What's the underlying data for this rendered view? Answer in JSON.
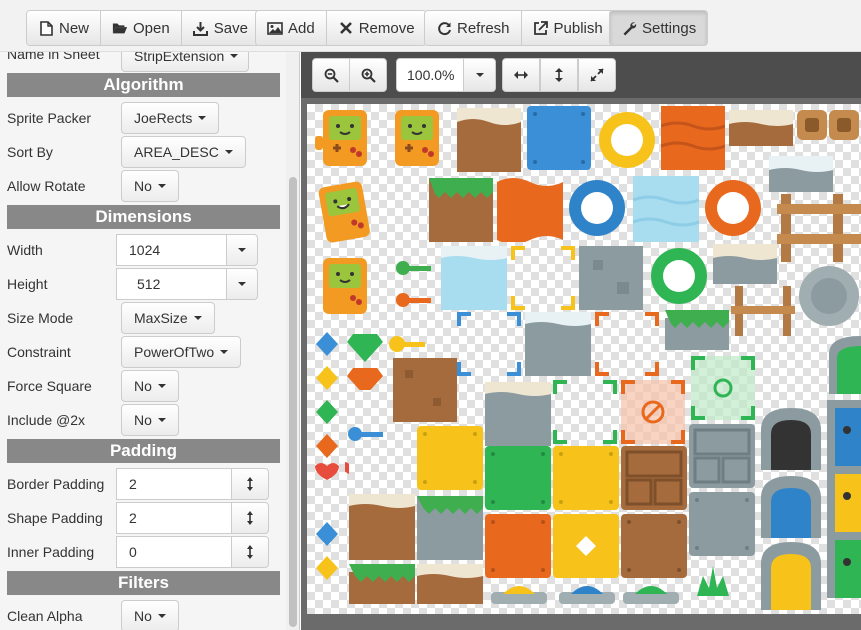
{
  "toolbar": {
    "new_label": "New",
    "open_label": "Open",
    "save_label": "Save",
    "add_label": "Add",
    "remove_label": "Remove",
    "refresh_label": "Refresh",
    "publish_label": "Publish",
    "settings_label": "Settings"
  },
  "sidebar": {
    "top_row": {
      "label": "Name in Sheet",
      "value": "StripExtension"
    },
    "algorithm": {
      "title": "Algorithm",
      "sprite_packer": {
        "label": "Sprite Packer",
        "value": "JoeRects"
      },
      "sort_by": {
        "label": "Sort By",
        "value": "AREA_DESC"
      },
      "allow_rotate": {
        "label": "Allow Rotate",
        "value": "No"
      }
    },
    "dimensions": {
      "title": "Dimensions",
      "width": {
        "label": "Width",
        "value": "1024"
      },
      "height": {
        "label": "Height",
        "value": "512"
      },
      "size_mode": {
        "label": "Size Mode",
        "value": "MaxSize"
      },
      "constraint": {
        "label": "Constraint",
        "value": "PowerOfTwo"
      },
      "force_square": {
        "label": "Force Square",
        "value": "No"
      },
      "include_2x": {
        "label": "Include @2x",
        "value": "No"
      }
    },
    "padding": {
      "title": "Padding",
      "border": {
        "label": "Border Padding",
        "value": "2"
      },
      "shape": {
        "label": "Shape Padding",
        "value": "2"
      },
      "inner": {
        "label": "Inner Padding",
        "value": "0"
      }
    },
    "filters": {
      "title": "Filters",
      "clean_alpha": {
        "label": "Clean Alpha",
        "value": "No"
      }
    }
  },
  "canvas": {
    "zoom_value": "100.0%"
  }
}
